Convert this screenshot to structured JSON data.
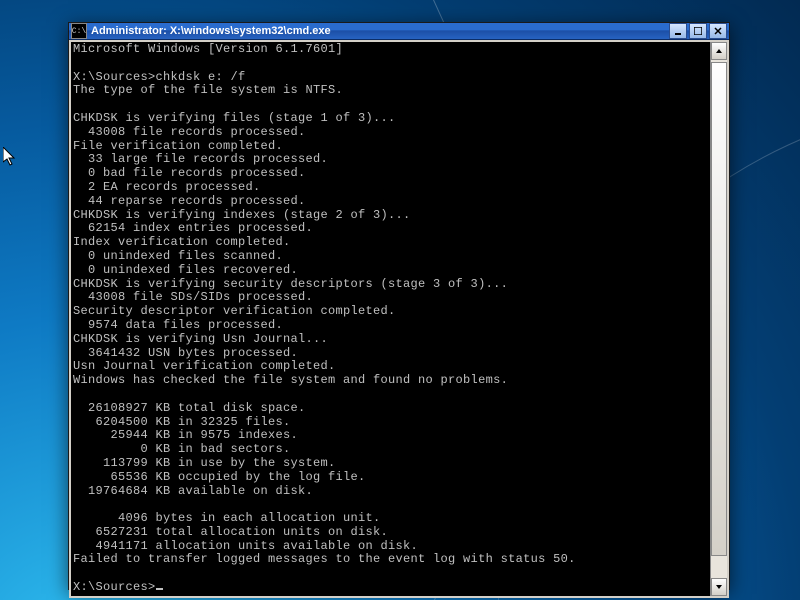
{
  "window": {
    "title": "Administrator: X:\\windows\\system32\\cmd.exe",
    "icon_glyph": "C:\\"
  },
  "header_line": "Microsoft Windows [Version 6.1.7601]",
  "prompt1": "X:\\Sources>",
  "command": "chkdsk e: /f",
  "output_lines": [
    "The type of the file system is NTFS.",
    "",
    "CHKDSK is verifying files (stage 1 of 3)...",
    "  43008 file records processed.",
    "File verification completed.",
    "  33 large file records processed.",
    "  0 bad file records processed.",
    "  2 EA records processed.",
    "  44 reparse records processed.",
    "CHKDSK is verifying indexes (stage 2 of 3)...",
    "  62154 index entries processed.",
    "Index verification completed.",
    "  0 unindexed files scanned.",
    "  0 unindexed files recovered.",
    "CHKDSK is verifying security descriptors (stage 3 of 3)...",
    "  43008 file SDs/SIDs processed.",
    "Security descriptor verification completed.",
    "  9574 data files processed.",
    "CHKDSK is verifying Usn Journal...",
    "  3641432 USN bytes processed.",
    "Usn Journal verification completed.",
    "Windows has checked the file system and found no problems.",
    "",
    "  26108927 KB total disk space.",
    "   6204500 KB in 32325 files.",
    "     25944 KB in 9575 indexes.",
    "         0 KB in bad sectors.",
    "    113799 KB in use by the system.",
    "     65536 KB occupied by the log file.",
    "  19764684 KB available on disk.",
    "",
    "      4096 bytes in each allocation unit.",
    "   6527231 total allocation units on disk.",
    "   4941171 allocation units available on disk.",
    "Failed to transfer logged messages to the event log with status 50."
  ],
  "prompt2": "X:\\Sources>"
}
